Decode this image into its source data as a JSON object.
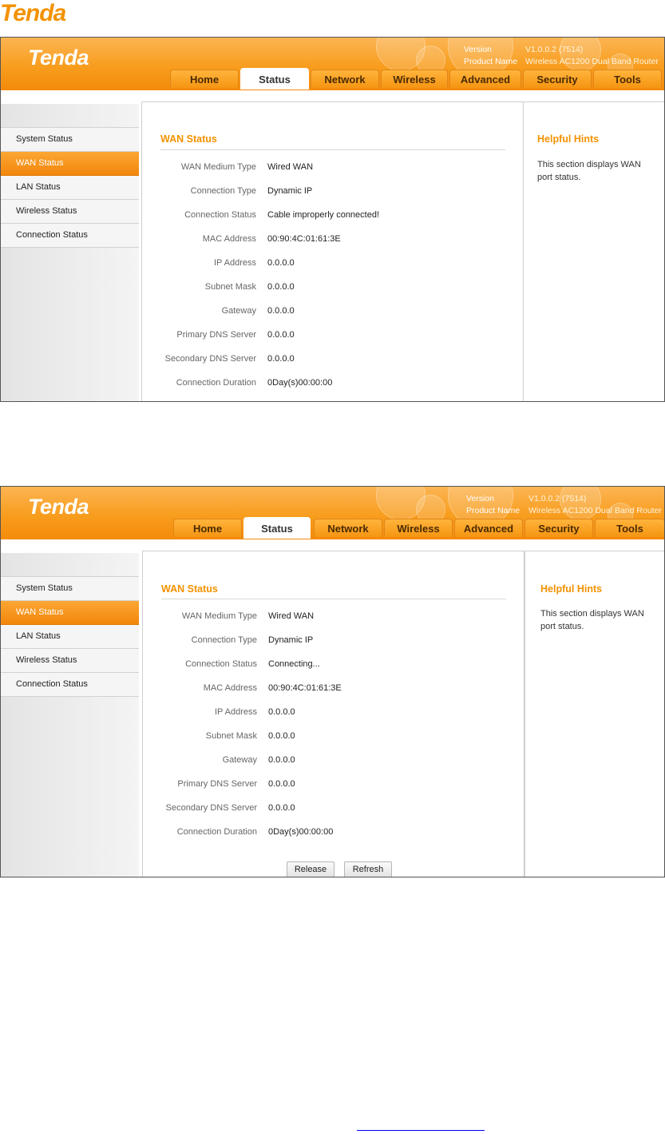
{
  "page": {
    "logo_text": "Tenda"
  },
  "screenshots": [
    {
      "brand": "Tenda",
      "version_label": "Version",
      "version_value": "V1.0.0.2 (7514)",
      "product_label": "Product Name",
      "product_value": "Wireless AC1200 Dual Band Router",
      "tabs": [
        "Home",
        "Status",
        "Network",
        "Wireless",
        "Advanced",
        "Security",
        "Tools"
      ],
      "active_tab": "Status",
      "sidebar": [
        "System Status",
        "WAN Status",
        "LAN Status",
        "Wireless Status",
        "Connection Status"
      ],
      "active_sidebar": "WAN Status",
      "section_title": "WAN Status",
      "rows": [
        {
          "label": "WAN Medium Type",
          "value": "Wired WAN"
        },
        {
          "label": "Connection Type",
          "value": "Dynamic IP"
        },
        {
          "label": "Connection Status",
          "value": "Cable improperly connected!"
        },
        {
          "label": "MAC Address",
          "value": "00:90:4C:01:61:3E"
        },
        {
          "label": "IP Address",
          "value": "0.0.0.0"
        },
        {
          "label": "Subnet Mask",
          "value": "0.0.0.0"
        },
        {
          "label": "Gateway",
          "value": "0.0.0.0"
        },
        {
          "label": "Primary DNS Server",
          "value": "0.0.0.0"
        },
        {
          "label": "Secondary DNS Server",
          "value": "0.0.0.0"
        },
        {
          "label": "Connection Duration",
          "value": "0Day(s)00:00:00"
        }
      ],
      "hints_title": "Helpful Hints",
      "hints_text": "This section displays WAN port status."
    },
    {
      "brand": "Tenda",
      "version_label": "Version",
      "version_value": "V1.0.0.2 (7514)",
      "product_label": "Product Name",
      "product_value": "Wireless AC1200 Dual Band Router",
      "tabs": [
        "Home",
        "Status",
        "Network",
        "Wireless",
        "Advanced",
        "Security",
        "Tools"
      ],
      "active_tab": "Status",
      "sidebar": [
        "System Status",
        "WAN Status",
        "LAN Status",
        "Wireless Status",
        "Connection Status"
      ],
      "active_sidebar": "WAN Status",
      "section_title": "WAN Status",
      "rows": [
        {
          "label": "WAN Medium Type",
          "value": "Wired WAN"
        },
        {
          "label": "Connection Type",
          "value": "Dynamic IP"
        },
        {
          "label": "Connection Status",
          "value": "Connecting..."
        },
        {
          "label": "MAC Address",
          "value": "00:90:4C:01:61:3E"
        },
        {
          "label": "IP Address",
          "value": "0.0.0.0"
        },
        {
          "label": "Subnet Mask",
          "value": "0.0.0.0"
        },
        {
          "label": "Gateway",
          "value": "0.0.0.0"
        },
        {
          "label": "Primary DNS Server",
          "value": "0.0.0.0"
        },
        {
          "label": "Secondary DNS Server",
          "value": "0.0.0.0"
        },
        {
          "label": "Connection Duration",
          "value": "0Day(s)00:00:00"
        }
      ],
      "hints_title": "Helpful Hints",
      "hints_text": "This section displays WAN port status.",
      "buttons": {
        "release": "Release",
        "refresh": "Refresh"
      }
    }
  ],
  "colors": {
    "accent": "#f39200",
    "banner": "#f89d1e",
    "footer_link": "#0000ff"
  }
}
